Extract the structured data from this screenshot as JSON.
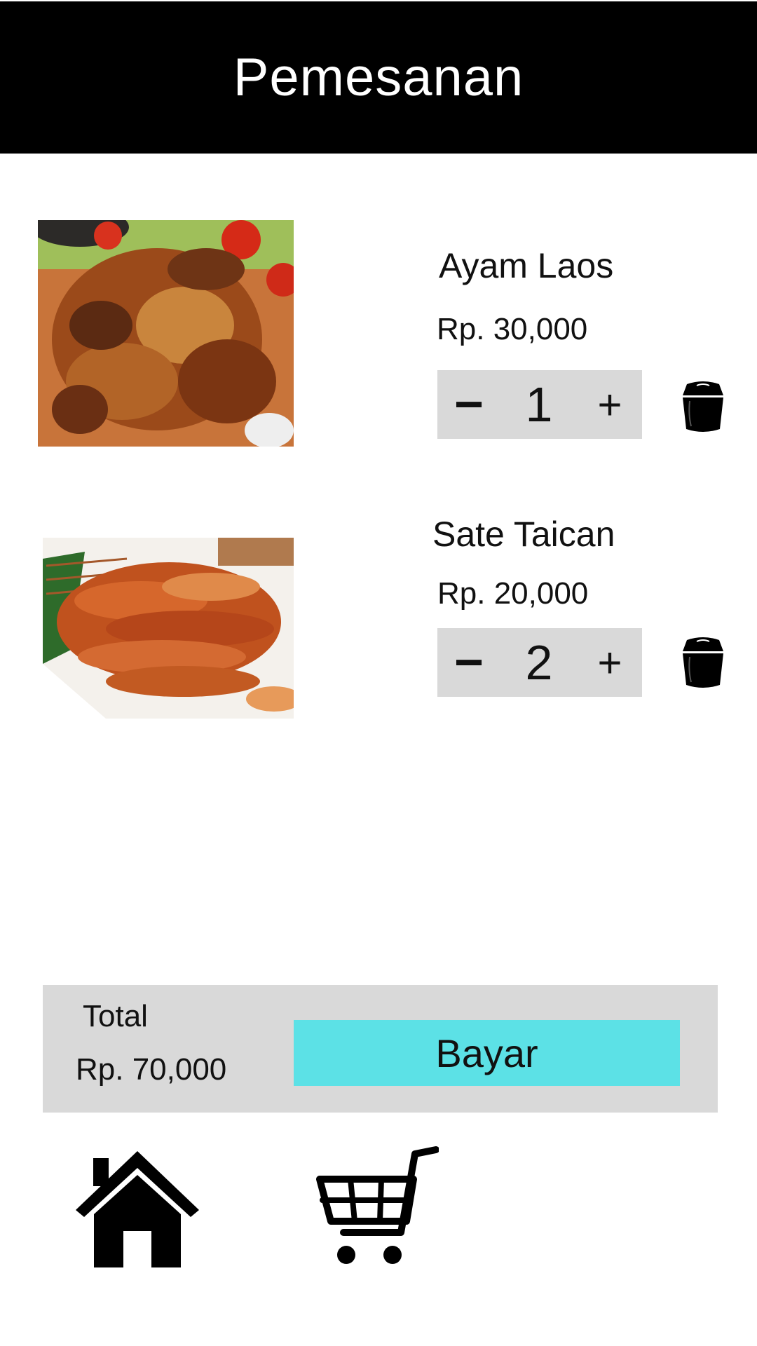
{
  "header": {
    "title": "Pemesanan"
  },
  "items": [
    {
      "name": "Ayam Laos",
      "price": "Rp. 30,000",
      "minus": "−",
      "qty": "1",
      "plus": "+"
    },
    {
      "name": "Sate Taican",
      "price": "Rp. 20,000",
      "minus": "−",
      "qty": "2",
      "plus": "+"
    }
  ],
  "summary": {
    "label": "Total",
    "value": "Rp. 70,000",
    "pay_label": "Bayar"
  },
  "nav": {
    "home_icon": "home-icon",
    "cart_icon": "cart-icon"
  },
  "colors": {
    "header_bg": "#000000",
    "panel_bg": "#d9d9d9",
    "pay_button": "#5ce1e6"
  }
}
